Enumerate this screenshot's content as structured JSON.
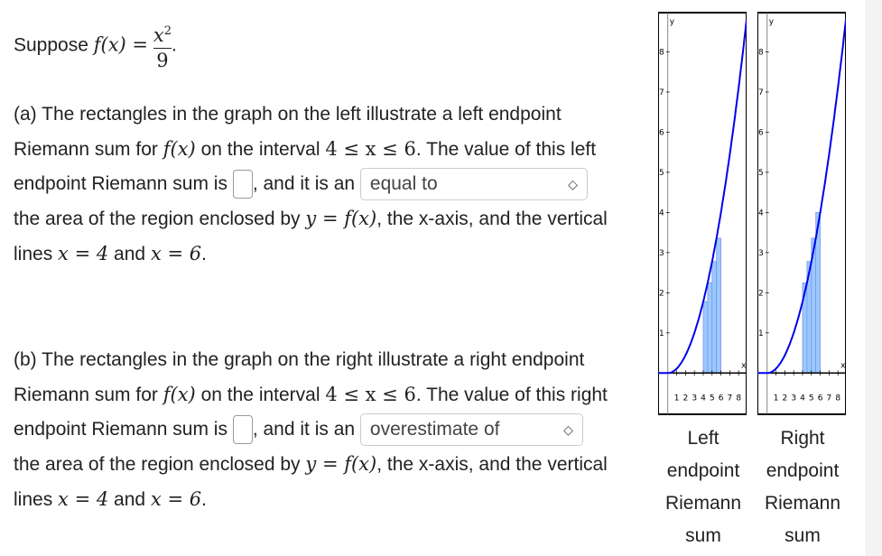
{
  "problem": {
    "intro": "Suppose",
    "func_lhs": "f(x) =",
    "func_num": "x",
    "func_exp": "2",
    "func_den": "9",
    "part_a": {
      "t1": "(a) The rectangles in the graph on the left illustrate a left endpoint Riemann sum for",
      "fx": "f(x)",
      "t2": "on the interval",
      "interval": "4 ≤ x ≤ 6",
      "t3": ". The value of this left endpoint Riemann sum is",
      "t4": ", and it is an",
      "select_value": "equal to",
      "t5": "the area of the region enclosed by",
      "eq": "y = f(x)",
      "t6": ", the x-axis, and the vertical lines",
      "x1": "x = 4",
      "and": "and",
      "x2": "x = 6",
      "end": "."
    },
    "part_b": {
      "t1": "(b) The rectangles in the graph on the right illustrate a right endpoint Riemann sum for",
      "fx": "f(x)",
      "t2": "on the interval",
      "interval": "4 ≤ x ≤ 6",
      "t3": ". The value of this right endpoint Riemann sum is",
      "t4": ", and it is an",
      "select_value": "overestimate of",
      "t5": "the area of the region enclosed by",
      "eq": "y = f(x)",
      "t6": ", the x-axis, and the vertical lines",
      "x1": "x = 4",
      "and": "and",
      "x2": "x = 6",
      "end": "."
    }
  },
  "captions": {
    "left": "Left endpoint Riemann sum",
    "right": "Right endpoint Riemann sum"
  },
  "chart_data": [
    {
      "type": "area",
      "function": "x^2/9",
      "xlim": [
        -1.1,
        8.9
      ],
      "ylim": [
        -1.05,
        9
      ],
      "xticks": [
        "1",
        "2",
        "3",
        "4",
        "5",
        "6",
        "7",
        "8"
      ],
      "yticks": [
        "1",
        "2",
        "3",
        "4",
        "5",
        "6",
        "7",
        "8"
      ],
      "xlabel": "x",
      "ylabel": "y",
      "rectangles": {
        "method": "left",
        "x": [
          4,
          4.5,
          5,
          5.5
        ],
        "width": 0.5,
        "heights": [
          1.78,
          2.25,
          2.78,
          3.36
        ]
      },
      "curve_color": "#0000ee",
      "rect_color": "#99c9ff"
    },
    {
      "type": "area",
      "function": "x^2/9",
      "xlim": [
        -1.1,
        8.9
      ],
      "ylim": [
        -1.05,
        9
      ],
      "xticks": [
        "1",
        "2",
        "3",
        "4",
        "5",
        "6",
        "7",
        "8"
      ],
      "yticks": [
        "1",
        "2",
        "3",
        "4",
        "5",
        "6",
        "7",
        "8"
      ],
      "xlabel": "x",
      "ylabel": "y",
      "rectangles": {
        "method": "right",
        "x": [
          4,
          4.5,
          5,
          5.5
        ],
        "width": 0.5,
        "heights": [
          2.25,
          2.78,
          3.36,
          4
        ]
      },
      "curve_color": "#0000ee",
      "rect_color": "#99c9ff"
    }
  ]
}
